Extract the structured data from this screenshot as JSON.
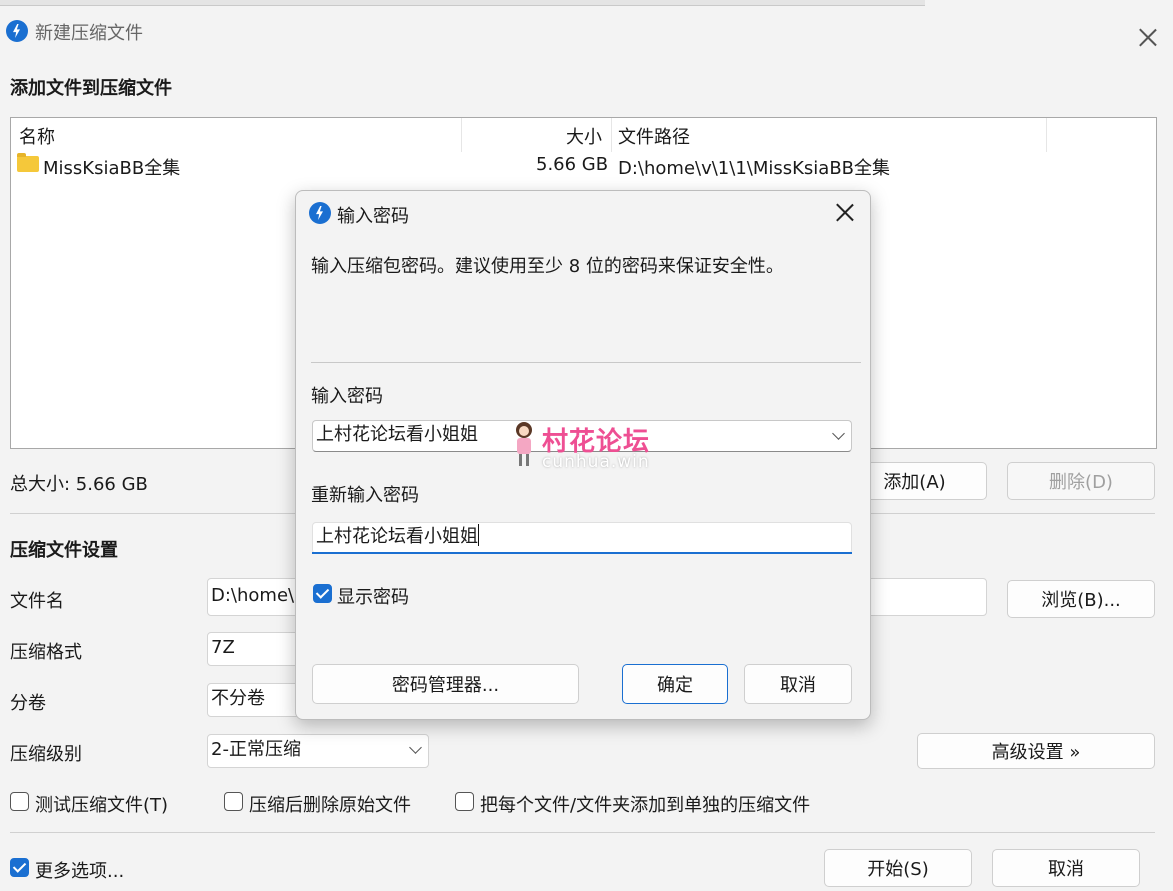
{
  "main": {
    "title": "新建压缩文件",
    "add_section_title": "添加文件到压缩文件",
    "columns": {
      "name": "名称",
      "size": "大小",
      "path": "文件路径"
    },
    "rows": [
      {
        "name": "MissKsiaBB全集",
        "size": "5.66 GB",
        "path": "D:\\home\\v\\1\\1\\MissKsiaBB全集"
      }
    ],
    "total_size": "总大小: 5.66 GB",
    "add_button": "添加(A)",
    "delete_button": "删除(D)",
    "settings_title": "压缩文件设置",
    "filename_label": "文件名",
    "filename_value": "D:\\home\\",
    "browse_button": "浏览(B)...",
    "format_label": "压缩格式",
    "format_value": "7Z",
    "split_label": "分卷",
    "split_value": "不分卷",
    "level_label": "压缩级别",
    "level_value": "2-正常压缩",
    "advanced_button": "高级设置 »",
    "test_checkbox": "测试压缩文件(T)",
    "delete_after_checkbox": "压缩后删除原始文件",
    "each_separate_checkbox": "把每个文件/文件夹添加到单独的压缩文件",
    "more_options_checkbox": "更多选项...",
    "start_button": "开始(S)",
    "cancel_button": "取消"
  },
  "dialog": {
    "title": "输入密码",
    "description": "输入压缩包密码。建议使用至少 8 位的密码来保证安全性。",
    "password_label": "输入密码",
    "password_value": "上村花论坛看小姐姐",
    "confirm_label": "重新输入密码",
    "confirm_value": "上村花论坛看小姐姐",
    "show_password": "显示密码",
    "show_password_checked": true,
    "manager_button": "密码管理器...",
    "ok_button": "确定",
    "cancel_button": "取消"
  },
  "watermark": {
    "text": "村花论坛",
    "url": "cunhua.win"
  },
  "colors": {
    "accent": "#1a6fd1",
    "folder": "#f5c83a",
    "watermark": "#ee4f93"
  }
}
